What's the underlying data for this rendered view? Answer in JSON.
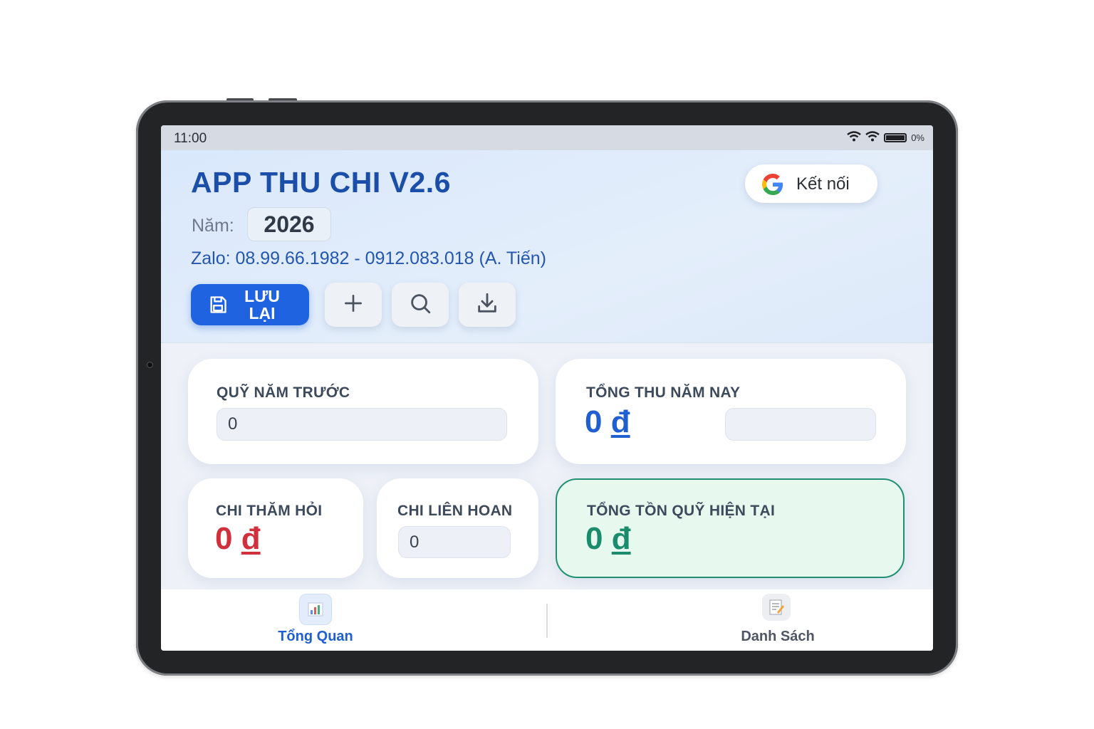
{
  "status_bar": {
    "time": "11:00",
    "battery": "0%"
  },
  "header": {
    "title": "APP THU CHI V2.6",
    "year_label": "Năm:",
    "year_value": "2026",
    "contact": "Zalo: 08.99.66.1982 - 0912.083.018 (A. Tiến)",
    "connect_label": "Kết nối",
    "save_label_line1": "LƯU",
    "save_label_line2": "LẠI"
  },
  "cards": {
    "prev_fund": {
      "title": "QUỸ NĂM TRƯỚC",
      "value": "0"
    },
    "total_income": {
      "title": "TỔNG THU NĂM NAY",
      "amount": "0",
      "currency": "đ",
      "input_value": ""
    },
    "visit_expense": {
      "title": "CHI THĂM HỎI",
      "amount": "0",
      "currency": "đ"
    },
    "party_expense": {
      "title": "CHI LIÊN HOAN",
      "value": "0"
    },
    "current_fund": {
      "title": "TỔNG TỒN QUỸ HIỆN TẠI",
      "amount": "0",
      "currency": "đ"
    }
  },
  "bottom_nav": {
    "items": [
      {
        "label": "Tổng Quan",
        "icon": "bar-chart-icon",
        "active": true
      },
      {
        "label": "Danh Sách",
        "icon": "memo-icon",
        "active": false
      }
    ]
  },
  "colors": {
    "primary": "#1f63e0",
    "title": "#1a4ea8",
    "income": "#1f5fd0",
    "expense": "#d0303c",
    "fund": "#1a8c6c"
  }
}
